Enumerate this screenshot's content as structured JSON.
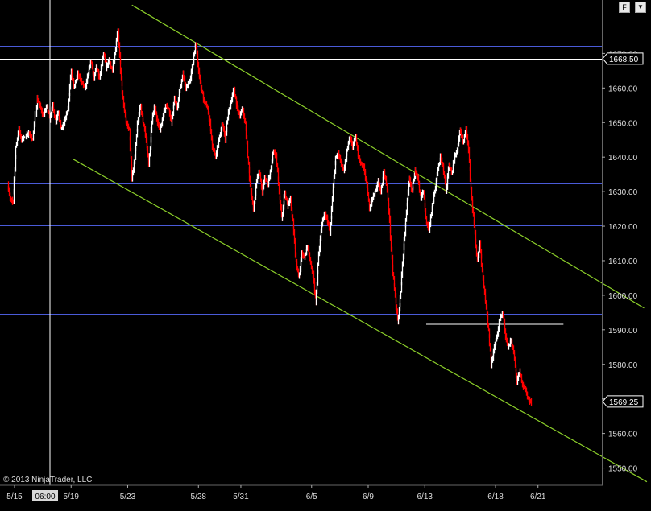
{
  "chart_data": {
    "type": "ohlc",
    "title": "",
    "xlabel": "",
    "ylabel": "",
    "ylim": [
      1545,
      1684
    ],
    "y_ticks": [
      "1550.00",
      "1560.00",
      "1570.00",
      "1580.00",
      "1590.00",
      "1600.00",
      "1610.00",
      "1620.00",
      "1630.00",
      "1640.00",
      "1650.00",
      "1660.00",
      "1670.00"
    ],
    "x_ticks": [
      {
        "label": "5/15",
        "day": 0
      },
      {
        "label": "5/19",
        "day": 4
      },
      {
        "label": "5/23",
        "day": 8
      },
      {
        "label": "5/28",
        "day": 13
      },
      {
        "label": "5/31",
        "day": 16
      },
      {
        "label": "6/5",
        "day": 21
      },
      {
        "label": "6/9",
        "day": 25
      },
      {
        "label": "6/13",
        "day": 29
      },
      {
        "label": "6/18",
        "day": 34
      },
      {
        "label": "6/21",
        "day": 37
      }
    ],
    "cursor_time_label": "06:00",
    "current_price_label": "1569.25",
    "last_price_label": "1668.50",
    "horizontal_levels": [
      1672.2,
      1668.5,
      1659.8,
      1648.0,
      1632.4,
      1620.3,
      1607.4,
      1594.7,
      1576.5,
      1558.6
    ],
    "channel_lines": [
      {
        "points": [
          [
            8.3,
            1684
          ],
          [
            44.5,
            1596.3
          ]
        ],
        "color": "#8ccf2a"
      },
      {
        "points": [
          [
            4.1,
            1639.5
          ],
          [
            44.7,
            1546
          ]
        ],
        "color": "#8ccf2a"
      }
    ],
    "support_line": {
      "points": [
        [
          29.1,
          1591.6
        ],
        [
          38.8,
          1591.6
        ]
      ],
      "color": "#ffffff"
    },
    "series": [
      {
        "name": "",
        "up_color": "#ffffff",
        "down_color": "#ff0000",
        "points": [
          [
            -0.5,
            1632
          ],
          [
            -0.3,
            1628
          ],
          [
            -0.1,
            1627
          ],
          [
            0.1,
            1643
          ],
          [
            0.3,
            1648
          ],
          [
            0.5,
            1645
          ],
          [
            0.8,
            1646
          ],
          [
            1.0,
            1647
          ],
          [
            1.3,
            1645
          ],
          [
            1.6,
            1657
          ],
          [
            1.8,
            1655
          ],
          [
            2.0,
            1652
          ],
          [
            2.3,
            1655
          ],
          [
            2.5,
            1651
          ],
          [
            2.7,
            1655
          ],
          [
            2.9,
            1650
          ],
          [
            3.1,
            1653
          ],
          [
            3.3,
            1648
          ],
          [
            3.5,
            1650
          ],
          [
            3.8,
            1654
          ],
          [
            4.0,
            1665
          ],
          [
            4.2,
            1660
          ],
          [
            4.5,
            1664
          ],
          [
            4.7,
            1662
          ],
          [
            5.0,
            1660
          ],
          [
            5.2,
            1664
          ],
          [
            5.4,
            1668
          ],
          [
            5.6,
            1663
          ],
          [
            5.8,
            1666
          ],
          [
            6.0,
            1663
          ],
          [
            6.3,
            1670
          ],
          [
            6.5,
            1666
          ],
          [
            6.7,
            1668
          ],
          [
            6.9,
            1665
          ],
          [
            7.1,
            1670
          ],
          [
            7.3,
            1677
          ],
          [
            7.5,
            1665
          ],
          [
            7.7,
            1655
          ],
          [
            7.9,
            1650
          ],
          [
            8.1,
            1648
          ],
          [
            8.3,
            1634
          ],
          [
            8.5,
            1640
          ],
          [
            8.7,
            1650
          ],
          [
            8.9,
            1655
          ],
          [
            9.1,
            1650
          ],
          [
            9.3,
            1645
          ],
          [
            9.5,
            1638
          ],
          [
            9.7,
            1650
          ],
          [
            9.9,
            1655
          ],
          [
            10.1,
            1650
          ],
          [
            10.3,
            1648
          ],
          [
            10.5,
            1652
          ],
          [
            10.7,
            1655
          ],
          [
            10.9,
            1654
          ],
          [
            11.1,
            1650
          ],
          [
            11.3,
            1657
          ],
          [
            11.5,
            1654
          ],
          [
            11.7,
            1660
          ],
          [
            11.9,
            1664
          ],
          [
            12.1,
            1660
          ],
          [
            12.4,
            1662
          ],
          [
            12.6,
            1667
          ],
          [
            12.8,
            1673
          ],
          [
            13.0,
            1665
          ],
          [
            13.2,
            1660
          ],
          [
            13.4,
            1656
          ],
          [
            13.6,
            1655
          ],
          [
            13.8,
            1650
          ],
          [
            14.0,
            1643
          ],
          [
            14.2,
            1640
          ],
          [
            14.5,
            1646
          ],
          [
            14.7,
            1650
          ],
          [
            14.9,
            1645
          ],
          [
            15.1,
            1653
          ],
          [
            15.3,
            1656
          ],
          [
            15.5,
            1660
          ],
          [
            15.7,
            1655
          ],
          [
            15.9,
            1652
          ],
          [
            16.1,
            1654
          ],
          [
            16.3,
            1650
          ],
          [
            16.5,
            1640
          ],
          [
            16.7,
            1630
          ],
          [
            16.9,
            1625
          ],
          [
            17.1,
            1633
          ],
          [
            17.3,
            1636
          ],
          [
            17.5,
            1630
          ],
          [
            17.7,
            1634
          ],
          [
            17.9,
            1632
          ],
          [
            18.1,
            1636
          ],
          [
            18.3,
            1642
          ],
          [
            18.5,
            1640
          ],
          [
            18.7,
            1630
          ],
          [
            18.9,
            1622
          ],
          [
            19.1,
            1630
          ],
          [
            19.3,
            1626
          ],
          [
            19.5,
            1628
          ],
          [
            19.7,
            1620
          ],
          [
            19.9,
            1610
          ],
          [
            20.1,
            1605
          ],
          [
            20.3,
            1612
          ],
          [
            20.5,
            1611
          ],
          [
            20.7,
            1614
          ],
          [
            20.9,
            1610
          ],
          [
            21.1,
            1606
          ],
          [
            21.3,
            1598
          ],
          [
            21.5,
            1612
          ],
          [
            21.7,
            1620
          ],
          [
            21.9,
            1624
          ],
          [
            22.1,
            1622
          ],
          [
            22.3,
            1618
          ],
          [
            22.5,
            1630
          ],
          [
            22.7,
            1640
          ],
          [
            22.9,
            1641
          ],
          [
            23.1,
            1638
          ],
          [
            23.3,
            1636
          ],
          [
            23.5,
            1642
          ],
          [
            23.7,
            1646
          ],
          [
            23.9,
            1643
          ],
          [
            24.1,
            1646
          ],
          [
            24.3,
            1640
          ],
          [
            24.5,
            1638
          ],
          [
            24.7,
            1637
          ],
          [
            24.9,
            1632
          ],
          [
            25.1,
            1625
          ],
          [
            25.3,
            1628
          ],
          [
            25.5,
            1630
          ],
          [
            25.7,
            1633
          ],
          [
            25.9,
            1630
          ],
          [
            26.1,
            1636
          ],
          [
            26.3,
            1632
          ],
          [
            26.5,
            1622
          ],
          [
            26.7,
            1608
          ],
          [
            26.9,
            1600
          ],
          [
            27.1,
            1592
          ],
          [
            27.3,
            1601
          ],
          [
            27.5,
            1614
          ],
          [
            27.7,
            1624
          ],
          [
            27.9,
            1634
          ],
          [
            28.1,
            1630
          ],
          [
            28.3,
            1636
          ],
          [
            28.5,
            1634
          ],
          [
            28.7,
            1628
          ],
          [
            28.9,
            1630
          ],
          [
            29.1,
            1621
          ],
          [
            29.3,
            1619
          ],
          [
            29.5,
            1625
          ],
          [
            29.7,
            1630
          ],
          [
            29.9,
            1636
          ],
          [
            30.1,
            1640
          ],
          [
            30.3,
            1637
          ],
          [
            30.5,
            1630
          ],
          [
            30.7,
            1638
          ],
          [
            30.9,
            1635
          ],
          [
            31.1,
            1640
          ],
          [
            31.3,
            1642
          ],
          [
            31.5,
            1648
          ],
          [
            31.7,
            1644
          ],
          [
            31.9,
            1648
          ],
          [
            32.1,
            1642
          ],
          [
            32.3,
            1628
          ],
          [
            32.5,
            1620
          ],
          [
            32.7,
            1610
          ],
          [
            32.9,
            1615
          ],
          [
            33.1,
            1605
          ],
          [
            33.3,
            1598
          ],
          [
            33.5,
            1590
          ],
          [
            33.7,
            1580
          ],
          [
            33.9,
            1585
          ],
          [
            34.1,
            1588
          ],
          [
            34.3,
            1593
          ],
          [
            34.5,
            1595
          ],
          [
            34.7,
            1588
          ],
          [
            34.9,
            1585
          ],
          [
            35.1,
            1587
          ],
          [
            35.3,
            1583
          ],
          [
            35.5,
            1575
          ],
          [
            35.7,
            1578
          ],
          [
            35.9,
            1574
          ],
          [
            36.1,
            1573
          ],
          [
            36.3,
            1570
          ],
          [
            36.5,
            1569
          ]
        ]
      }
    ]
  },
  "ui": {
    "copyright": "© 2013 NinjaTrader, LLC",
    "format_button": "F",
    "menu_button": "▼"
  }
}
